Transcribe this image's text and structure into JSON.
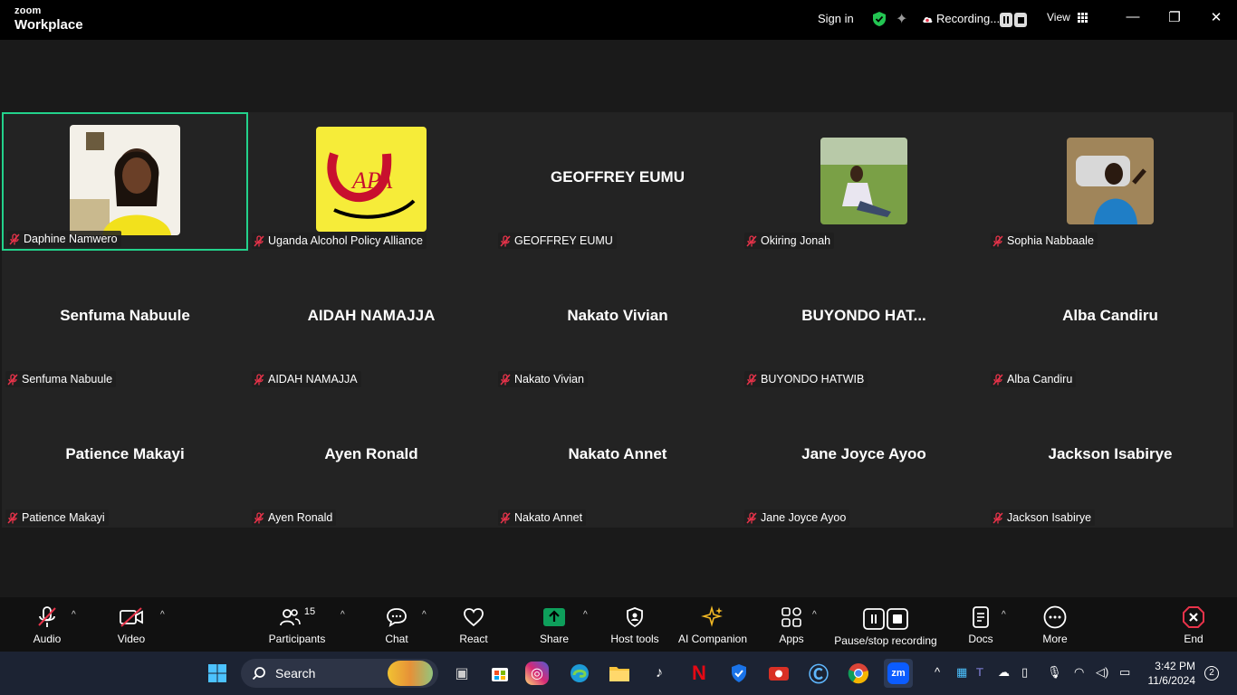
{
  "titlebar": {
    "brand_top": "zoom",
    "brand_bottom": "Workplace",
    "signin": "Sign in",
    "recording": "Recording...",
    "view": "View"
  },
  "participants": [
    {
      "display": "Daphine Namwero",
      "tag": "Daphine Namwero",
      "photo": "photo-person-yellow"
    },
    {
      "display": "Uganda Alcohol Policy Alliance",
      "tag": "Uganda Alcohol Policy Alliance",
      "photo": "uapa-logo",
      "logo_text": "UAPA"
    },
    {
      "display": "GEOFFREY EUMU",
      "tag": "GEOFFREY EUMU"
    },
    {
      "display": "Okiring Jonah",
      "tag": "Okiring Jonah",
      "photo": "photo-person-grass"
    },
    {
      "display": "Sophia Nabbaale",
      "tag": "Sophia Nabbaale",
      "photo": "photo-person-car"
    },
    {
      "display": "Senfuma Nabuule",
      "tag": "Senfuma Nabuule"
    },
    {
      "display": "AIDAH NAMAJJA",
      "tag": "AIDAH NAMAJJA"
    },
    {
      "display": "Nakato Vivian",
      "tag": "Nakato Vivian"
    },
    {
      "display": "BUYONDO  HAT...",
      "tag": "BUYONDO HATWIB"
    },
    {
      "display": "Alba Candiru",
      "tag": "Alba Candiru"
    },
    {
      "display": "Patience Makayi",
      "tag": "Patience Makayi"
    },
    {
      "display": "Ayen Ronald",
      "tag": "Ayen Ronald"
    },
    {
      "display": "Nakato Annet",
      "tag": "Nakato Annet"
    },
    {
      "display": "Jane Joyce Ayoo",
      "tag": "Jane Joyce Ayoo"
    },
    {
      "display": "Jackson Isabirye",
      "tag": "Jackson Isabirye"
    }
  ],
  "toolbar": {
    "audio": "Audio",
    "video": "Video",
    "participants": "Participants",
    "participants_count": "15",
    "chat": "Chat",
    "react": "React",
    "share": "Share",
    "host_tools": "Host tools",
    "ai_companion": "AI Companion",
    "apps": "Apps",
    "pause_stop": "Pause/stop recording",
    "docs": "Docs",
    "more": "More",
    "end": "End"
  },
  "taskbar": {
    "search": "Search",
    "time": "3:42 PM",
    "date": "11/6/2024",
    "notifications": "2"
  },
  "colors": {
    "active_speaker": "#23d18b",
    "share_green": "#0e9f5b",
    "end_red": "#e8334a"
  }
}
